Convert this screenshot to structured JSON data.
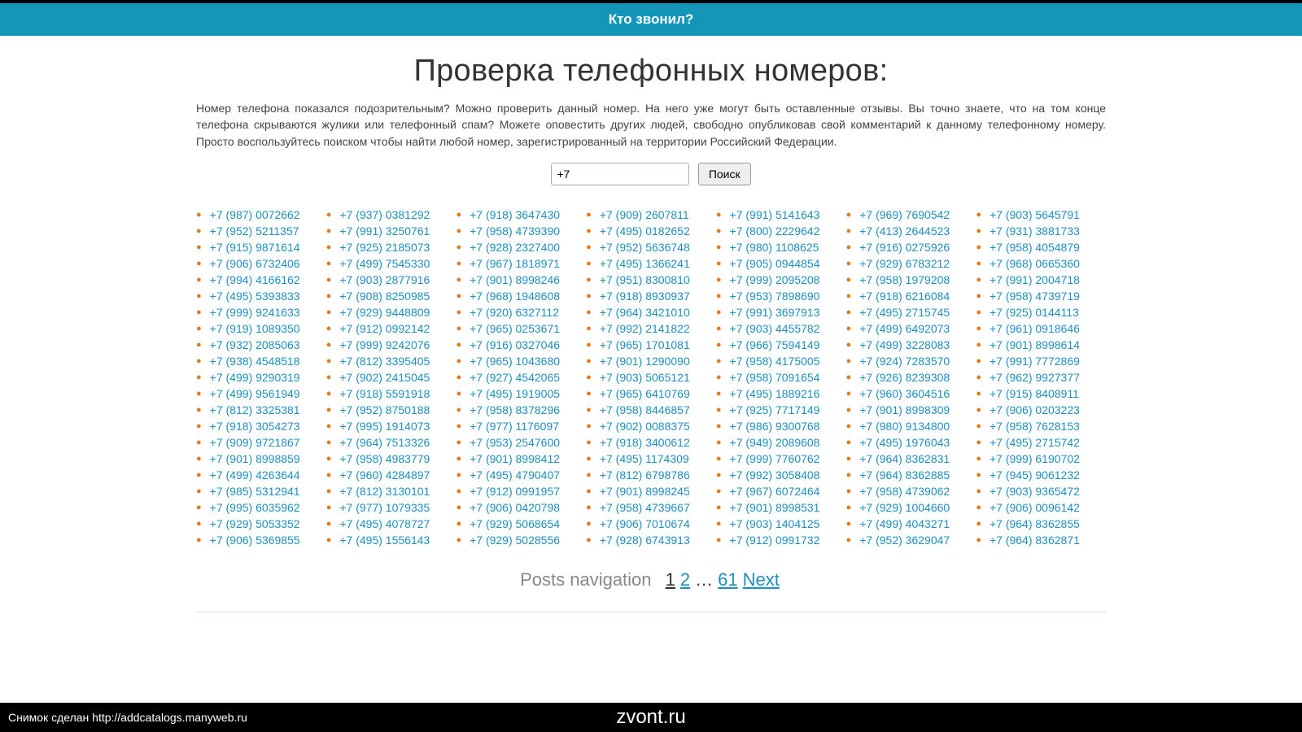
{
  "header": {
    "title": "Кто звонил?"
  },
  "page": {
    "title": "Проверка телефонных номеров:",
    "intro": "Номер телефона показался подозрительным? Можно проверить данный номер. На него уже могут быть оставленные отзывы. Вы точно знаете, что на том конце телефона скрываются жулики или телефонный спам? Можете оповестить других людей, свободно опубликовав свой комментарий к данному телефонному номеру. Просто воспользуйтесь поиском чтобы найти любой номер, зарегистрированный на территории Российский Федерации."
  },
  "search": {
    "value": "+7",
    "button": "Поиск"
  },
  "columns": [
    [
      "+7 (987) 0072662",
      "+7 (952) 5211357",
      "+7 (915) 9871614",
      "+7 (906) 6732406",
      "+7 (994) 4166162",
      "+7 (495) 5393833",
      "+7 (999) 9241633",
      "+7 (919) 1089350",
      "+7 (932) 2085063",
      "+7 (938) 4548518",
      "+7 (499) 9290319",
      "+7 (499) 9561949",
      "+7 (812) 3325381",
      "+7 (918) 3054273",
      "+7 (909) 9721867",
      "+7 (901) 8998859",
      "+7 (499) 4263644",
      "+7 (985) 5312941",
      "+7 (995) 6035962",
      "+7 (929) 5053352",
      "+7 (906) 5369855"
    ],
    [
      "+7 (937) 0381292",
      "+7 (991) 3250761",
      "+7 (925) 2185073",
      "+7 (499) 7545330",
      "+7 (903) 2877916",
      "+7 (908) 8250985",
      "+7 (929) 9448809",
      "+7 (912) 0992142",
      "+7 (999) 9242076",
      "+7 (812) 3395405",
      "+7 (902) 2415045",
      "+7 (918) 5591918",
      "+7 (952) 8750188",
      "+7 (995) 1914073",
      "+7 (964) 7513326",
      "+7 (958) 4983779",
      "+7 (960) 4284897",
      "+7 (812) 3130101",
      "+7 (977) 1079335",
      "+7 (495) 4078727",
      "+7 (495) 1556143"
    ],
    [
      "+7 (918) 3647430",
      "+7 (958) 4739390",
      "+7 (928) 2327400",
      "+7 (967) 1818971",
      "+7 (901) 8998246",
      "+7 (968) 1948608",
      "+7 (920) 6327112",
      "+7 (965) 0253671",
      "+7 (916) 0327046",
      "+7 (965) 1043680",
      "+7 (927) 4542065",
      "+7 (495) 1919005",
      "+7 (958) 8378296",
      "+7 (977) 1176097",
      "+7 (953) 2547600",
      "+7 (901) 8998412",
      "+7 (495) 4790407",
      "+7 (912) 0991957",
      "+7 (906) 0420798",
      "+7 (929) 5068654",
      "+7 (929) 5028556"
    ],
    [
      "+7 (909) 2607811",
      "+7 (495) 0182652",
      "+7 (952) 5636748",
      "+7 (495) 1366241",
      "+7 (951) 8300810",
      "+7 (918) 8930937",
      "+7 (964) 3421010",
      "+7 (992) 2141822",
      "+7 (965) 1701081",
      "+7 (901) 1290090",
      "+7 (903) 5065121",
      "+7 (965) 6410769",
      "+7 (958) 8446857",
      "+7 (902) 0088375",
      "+7 (918) 3400612",
      "+7 (495) 1174309",
      "+7 (812) 6798786",
      "+7 (901) 8998245",
      "+7 (958) 4739667",
      "+7 (906) 7010674",
      "+7 (928) 6743913"
    ],
    [
      "+7 (991) 5141643",
      "+7 (800) 2229642",
      "+7 (980) 1108625",
      "+7 (905) 0944854",
      "+7 (999) 2095208",
      "+7 (953) 7898690",
      "+7 (991) 3697913",
      "+7 (903) 4455782",
      "+7 (966) 7594149",
      "+7 (958) 4175005",
      "+7 (958) 7091654",
      "+7 (495) 1889216",
      "+7 (925) 7717149",
      "+7 (986) 9300768",
      "+7 (949) 2089608",
      "+7 (999) 7760762",
      "+7 (992) 3058408",
      "+7 (967) 6072464",
      "+7 (901) 8998531",
      "+7 (903) 1404125",
      "+7 (912) 0991732"
    ],
    [
      "+7 (969) 7690542",
      "+7 (413) 2644523",
      "+7 (916) 0275926",
      "+7 (929) 6783212",
      "+7 (958) 1979208",
      "+7 (918) 6216084",
      "+7 (495) 2715745",
      "+7 (499) 6492073",
      "+7 (499) 3228083",
      "+7 (924) 7283570",
      "+7 (926) 8239308",
      "+7 (960) 3604516",
      "+7 (901) 8998309",
      "+7 (980) 9134800",
      "+7 (495) 1976043",
      "+7 (964) 8362831",
      "+7 (964) 8362885",
      "+7 (958) 4739062",
      "+7 (929) 1004660",
      "+7 (499) 4043271",
      "+7 (952) 3629047"
    ],
    [
      "+7 (903) 5645791",
      "+7 (931) 3881733",
      "+7 (958) 4054879",
      "+7 (968) 0665360",
      "+7 (991) 2004718",
      "+7 (958) 4739719",
      "+7 (925) 0144113",
      "+7 (961) 0918646",
      "+7 (901) 8998614",
      "+7 (991) 7772869",
      "+7 (962) 9927377",
      "+7 (915) 8408911",
      "+7 (906) 0203223",
      "+7 (958) 7628153",
      "+7 (495) 2715742",
      "+7 (999) 6190702",
      "+7 (945) 9061232",
      "+7 (903) 9365472",
      "+7 (906) 0096142",
      "+7 (964) 8362855",
      "+7 (964) 8362871"
    ]
  ],
  "pagination": {
    "label": "Posts navigation",
    "pages": [
      "1",
      "2",
      "…",
      "61"
    ],
    "next": "Next"
  },
  "footer": {
    "left": "Снимок сделан http://addcatalogs.manyweb.ru",
    "center": "zvont.ru"
  }
}
